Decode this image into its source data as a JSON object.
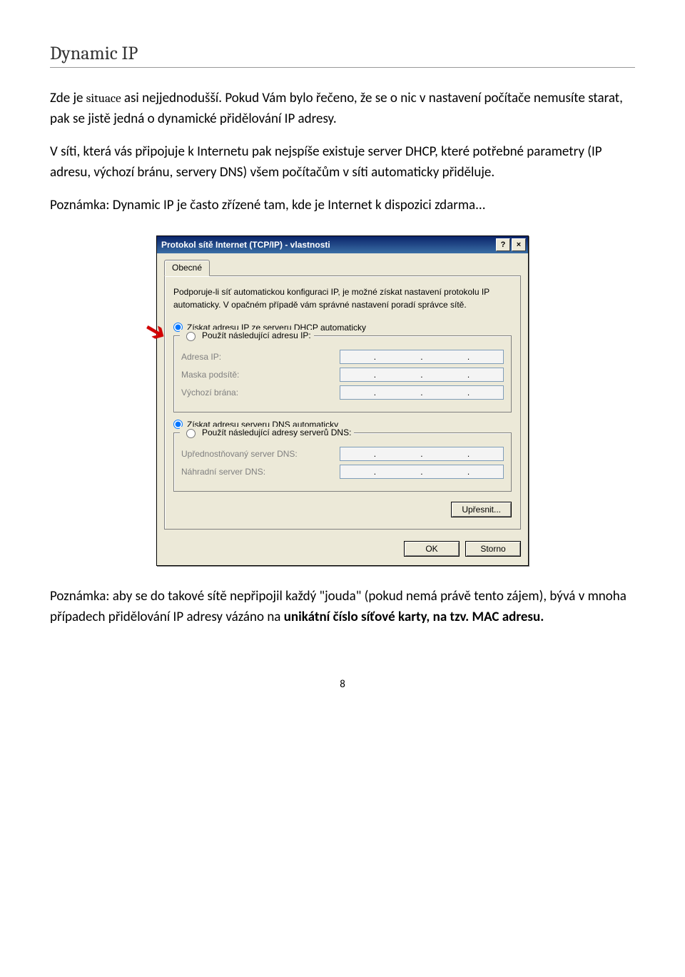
{
  "heading": "Dynamic IP",
  "para1_pre": "Zde je ",
  "para1_situace": "situace",
  "para1_post": " asi nejjednodušší. Pokud Vám bylo řečeno, že se o nic v nastavení počítače nemusíte starat, pak se jistě jedná o dynamické přidělování IP adresy.",
  "para2": "V síti, která vás připojuje k Internetu pak nejspíše existuje server DHCP, které potřebné parametry (IP adresu, výchozí bránu, servery DNS) všem počítačům v síti automaticky přiděluje.",
  "para3": "Poznámka: Dynamic IP je často zřízené tam, kde je Internet k dispozici zdarma...",
  "para4_a": "Poznámka: aby se do takové sítě nepřipojil každý \"jouda\" (pokud nemá právě tento zájem), bývá v mnoha případech přidělování IP adresy vázáno na ",
  "para4_bold": "unikátní číslo síťové karty, na tzv. MAC adresu.",
  "pageNumber": "8",
  "dialog": {
    "title": "Protokol sítě Internet (TCP/IP) - vlastnosti",
    "helpGlyph": "?",
    "closeGlyph": "×",
    "tabGeneral": "Obecné",
    "desc": "Podporuje-li síť automatickou konfiguraci IP, je možné získat nastavení protokolu IP automaticky. V opačném případě vám správné nastavení poradí správce sítě.",
    "radioAutoIP": "Získat adresu IP ze serveru DHCP automaticky",
    "radioManualIP": "Použít následující adresu IP:",
    "lblIP": "Adresa IP:",
    "lblMask": "Maska podsítě:",
    "lblGateway": "Výchozí brána:",
    "radioAutoDNS": "Získat adresu serveru DNS automaticky",
    "radioManualDNS": "Použít následující adresy serverů DNS:",
    "lblDNS1": "Upřednostňovaný server DNS:",
    "lblDNS2": "Náhradní server DNS:",
    "btnAdvanced": "Upřesnit...",
    "btnOK": "OK",
    "btnCancel": "Storno"
  }
}
